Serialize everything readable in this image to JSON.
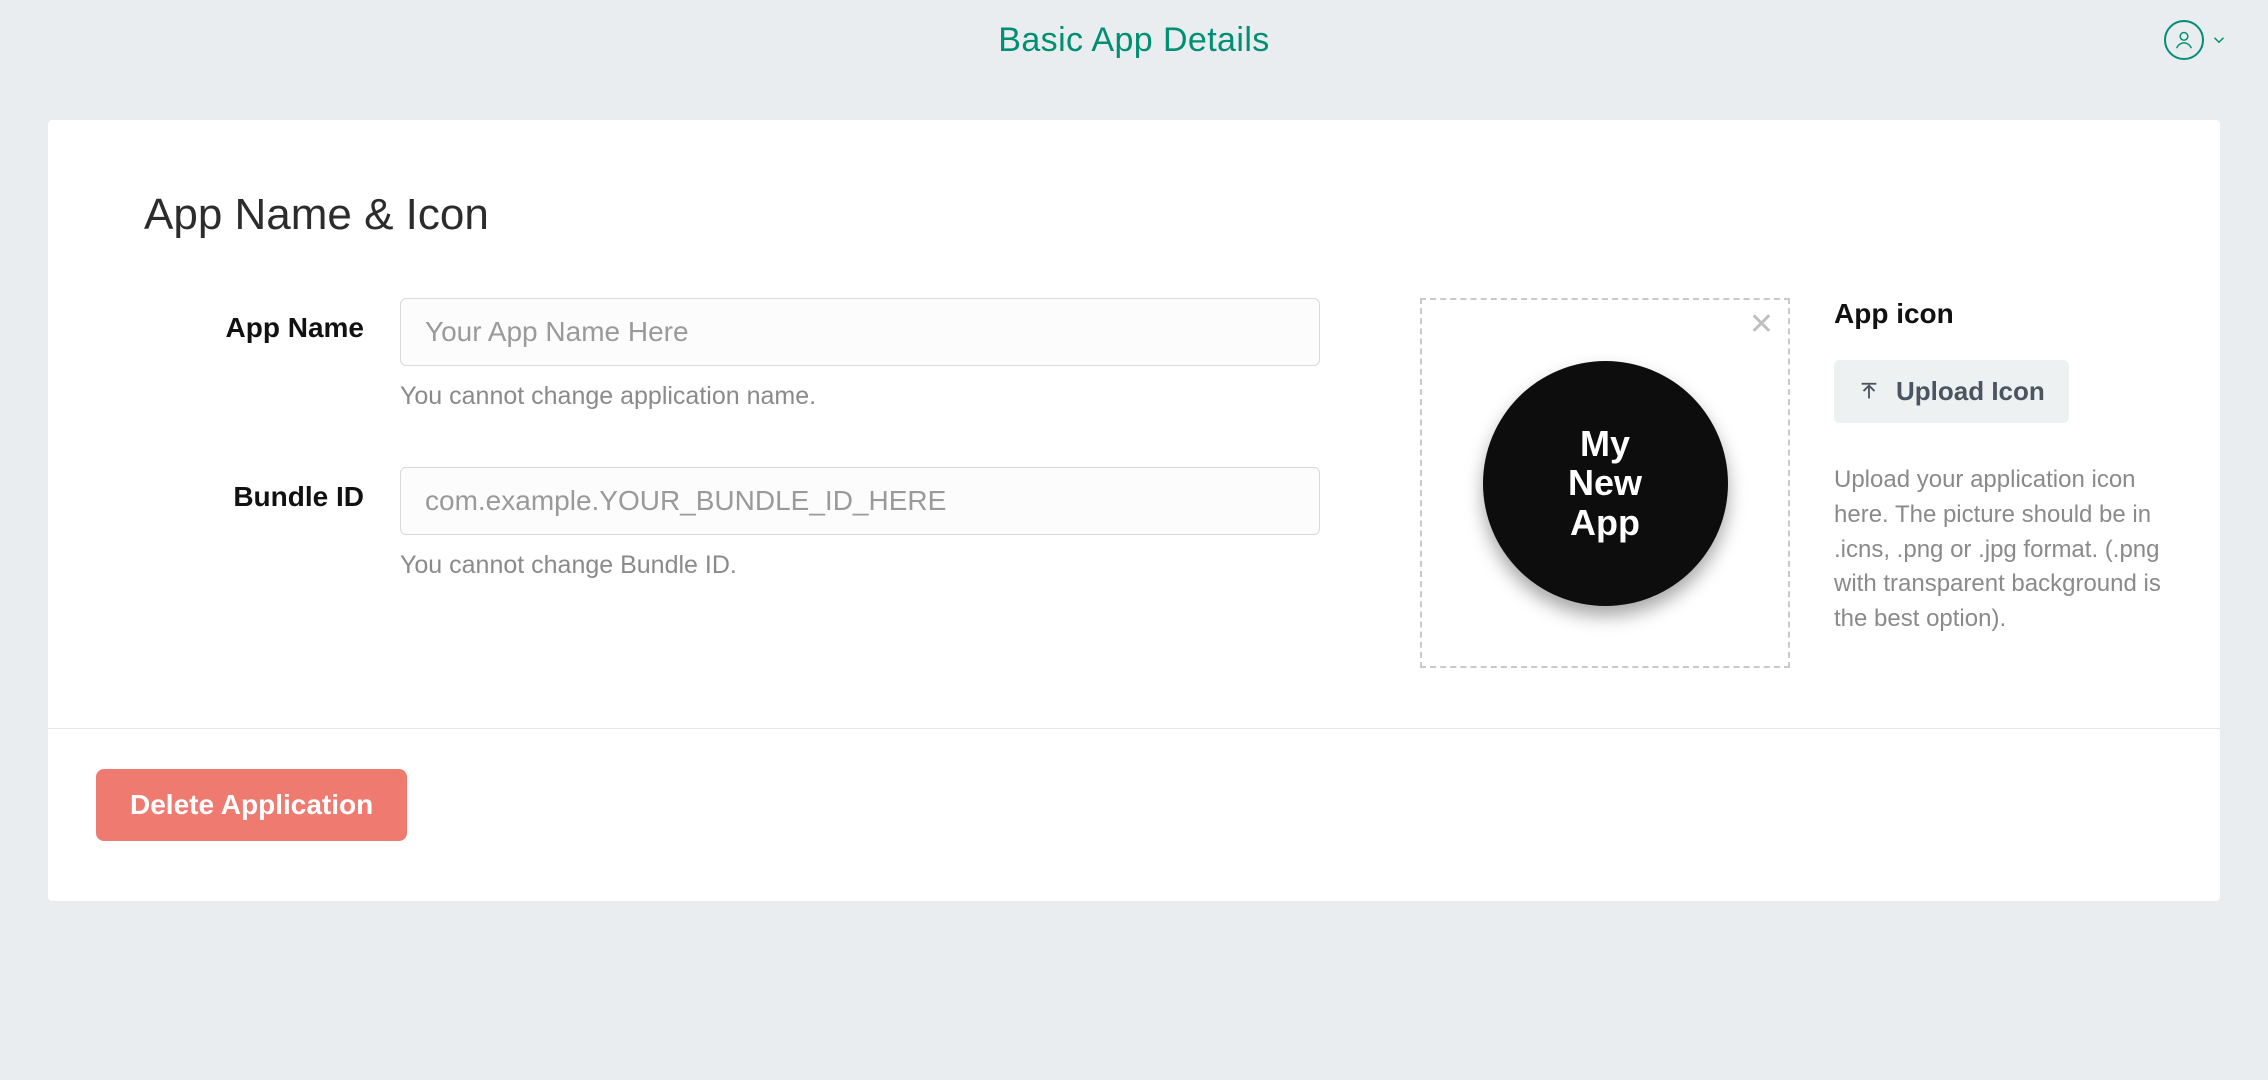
{
  "header": {
    "title": "Basic App Details"
  },
  "section": {
    "title": "App Name & Icon"
  },
  "form": {
    "appName": {
      "label": "App Name",
      "placeholder": "Your App Name Here",
      "help": "You cannot change application name."
    },
    "bundleId": {
      "label": "Bundle ID",
      "placeholder": "com.example.YOUR_BUNDLE_ID_HERE",
      "help": "You cannot change Bundle ID."
    }
  },
  "icon": {
    "preview_text": "My\nNew\nApp",
    "title": "App icon",
    "upload_label": "Upload Icon",
    "help": "Upload your application icon here. The picture should be in .icns, .png or .jpg format. (.png with transparent background is the best option)."
  },
  "footer": {
    "delete_label": "Delete Application"
  }
}
